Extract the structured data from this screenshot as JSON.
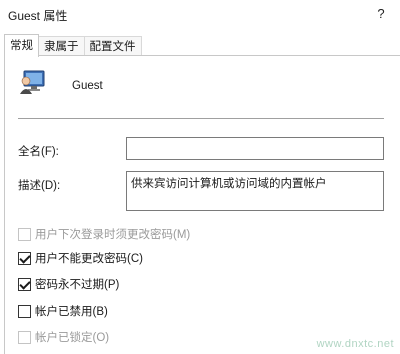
{
  "window": {
    "title": "Guest 属性",
    "help_label": "?"
  },
  "tabs": [
    {
      "label": "常规",
      "active": true
    },
    {
      "label": "隶属于",
      "active": false
    },
    {
      "label": "配置文件",
      "active": false
    }
  ],
  "user": {
    "name": "Guest",
    "icon": "user-monitor-icon"
  },
  "fields": {
    "fullname_label": "全名(F):",
    "fullname_value": "",
    "description_label": "描述(D):",
    "description_value": "供来宾访问计算机或访问域的内置帐户"
  },
  "checkboxes": [
    {
      "label": "用户下次登录时须更改密码(M)",
      "checked": false,
      "disabled": true
    },
    {
      "label": "用户不能更改密码(C)",
      "checked": true,
      "disabled": false
    },
    {
      "label": "密码永不过期(P)",
      "checked": true,
      "disabled": false
    },
    {
      "label": "帐户已禁用(B)",
      "checked": false,
      "disabled": false
    },
    {
      "label": "帐户已锁定(O)",
      "checked": false,
      "disabled": true
    }
  ],
  "watermark": "www.dnxtc.net"
}
